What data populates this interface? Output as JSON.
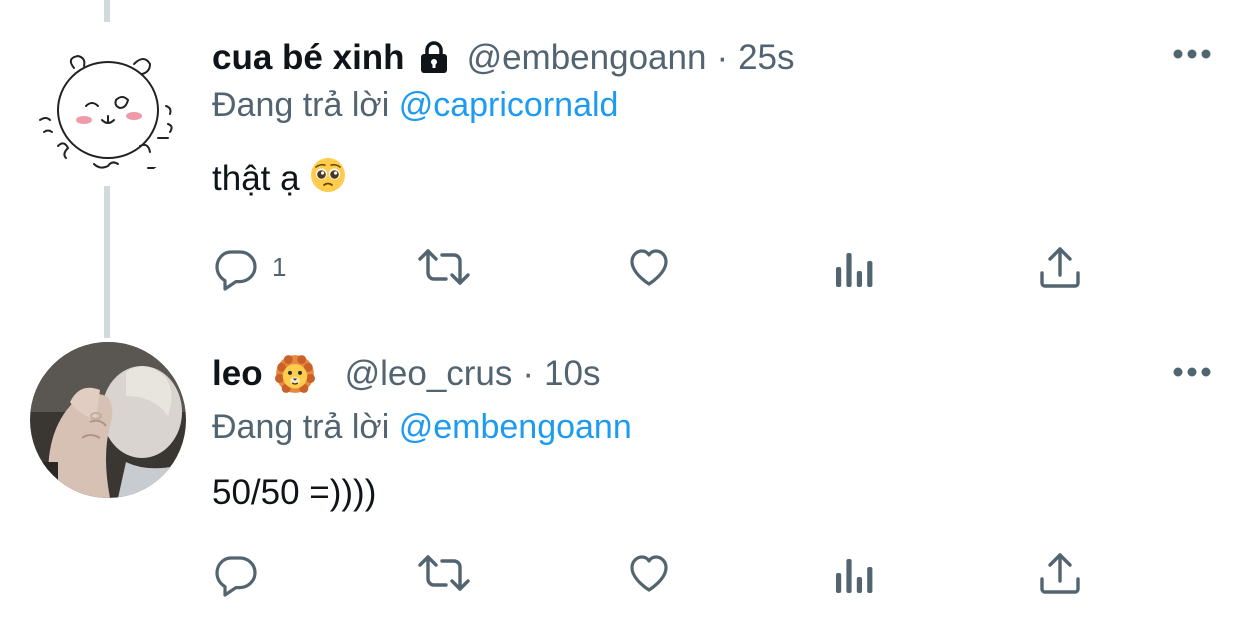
{
  "tweets": [
    {
      "display_name": "cua bé xinh",
      "badge_icon": "lock-icon",
      "handle": "@embengoann",
      "separator": "·",
      "time": "25s",
      "reply_prefix": "Đang trả lời",
      "reply_to": "@capricornald",
      "text": "thật ạ",
      "text_emoji": "pleading-face-emoji",
      "reply_count": "1",
      "avatar": "drawn-hamster-avatar"
    },
    {
      "display_name": "leo",
      "badge_icon": "lion-face-emoji",
      "handle": "@leo_crus",
      "separator": "·",
      "time": "10s",
      "reply_prefix": "Đang trả lời",
      "reply_to": "@embengoann",
      "text": "50/50 =))))",
      "reply_count": "",
      "avatar": "photo-hand-on-face-avatar"
    }
  ],
  "colors": {
    "text_primary": "#0f1419",
    "text_secondary": "#536471",
    "accent": "#1d9bf0",
    "thread_line": "#cfd9de"
  },
  "action_icons": [
    "reply-icon",
    "retweet-icon",
    "like-icon",
    "analytics-icon",
    "share-icon"
  ]
}
